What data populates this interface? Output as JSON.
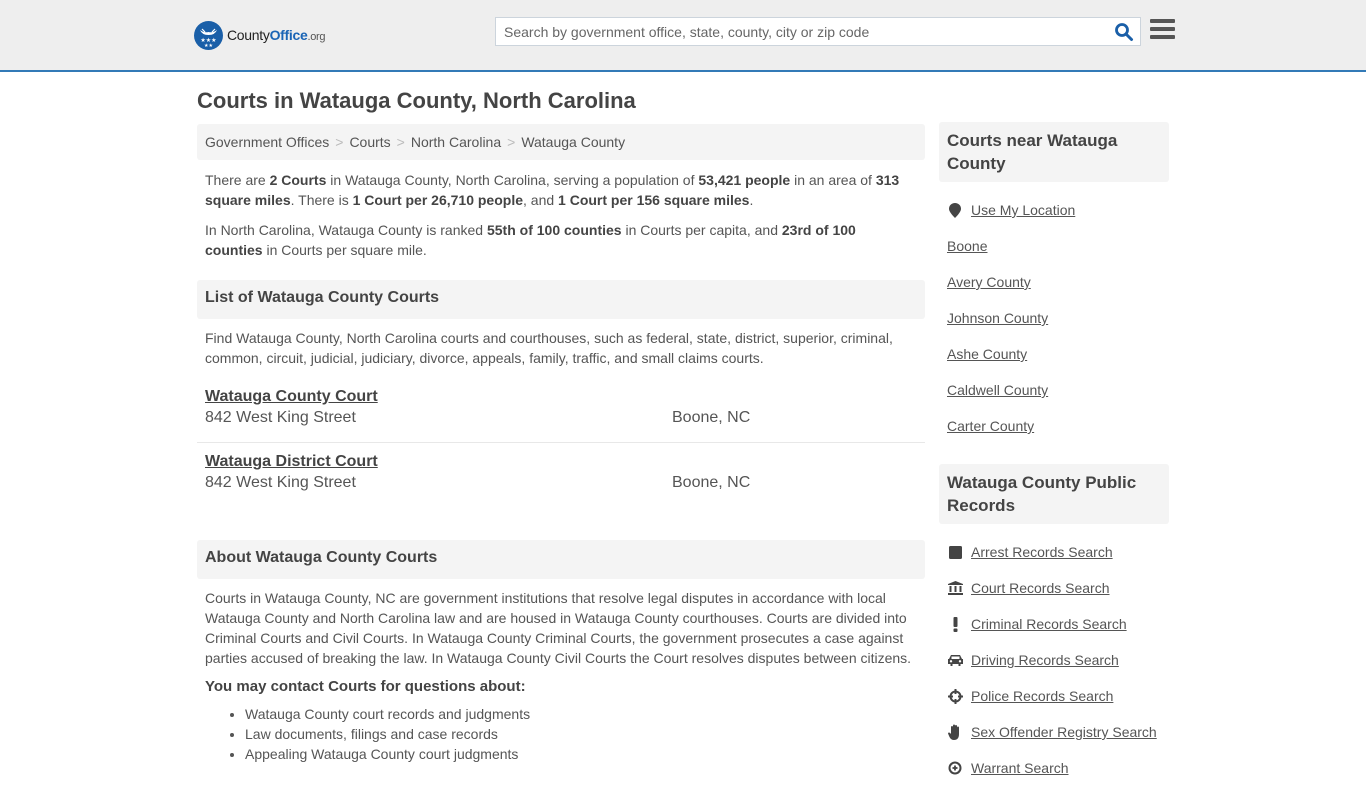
{
  "header": {
    "logo": {
      "county": "County",
      "office": "Office",
      "org": ".org"
    },
    "search": {
      "placeholder": "Search by government office, state, county, city or zip code",
      "value": ""
    },
    "search_icon": "magnifier-icon",
    "menu_icon": "hamburger-icon"
  },
  "page_title": "Courts in Watauga County, North Carolina",
  "breadcrumb": [
    "Government Offices",
    "Courts",
    "North Carolina",
    "Watauga County"
  ],
  "summary": {
    "p1": {
      "t1": "There are ",
      "b1": "2 Courts",
      "t2": " in Watauga County, North Carolina, serving a population of ",
      "b2": "53,421 people",
      "t3": " in an area of ",
      "b3": "313 square miles",
      "t4": ". There is ",
      "b4": "1 Court per 26,710 people",
      "t5": ", and ",
      "b5": "1 Court per 156 square miles",
      "t6": "."
    },
    "p2": {
      "t1": "In North Carolina, Watauga County is ranked ",
      "b1": "55th of 100 counties",
      "t2": " in Courts per capita, and ",
      "b2": "23rd of 100 counties",
      "t3": " in Courts per square mile."
    }
  },
  "list_section": {
    "heading": "List of Watauga County Courts",
    "intro": "Find Watauga County, North Carolina courts and courthouses, such as federal, state, district, superior, criminal, common, circuit, judicial, judiciary, divorce, appeals, family, traffic, and small claims courts.",
    "courts": [
      {
        "name": "Watauga County Court",
        "address": "842 West King Street",
        "city": "Boone, NC"
      },
      {
        "name": "Watauga District Court",
        "address": "842 West King Street",
        "city": "Boone, NC"
      }
    ]
  },
  "about_section": {
    "heading": "About Watauga County Courts",
    "text": "Courts in Watauga County, NC are government institutions that resolve legal disputes in accordance with local Watauga County and North Carolina law and are housed in Watauga County courthouses. Courts are divided into Criminal Courts and Civil Courts. In Watauga County Criminal Courts, the government prosecutes a case against parties accused of breaking the law. In Watauga County Civil Courts the Court resolves disputes between citizens.",
    "contact_heading": "You may contact Courts for questions about:",
    "contact_items": [
      "Watauga County court records and judgments",
      "Law documents, filings and case records",
      "Appealing Watauga County court judgments"
    ]
  },
  "sidebar": {
    "nearby": {
      "heading": "Courts near Watauga County",
      "use_location": "Use My Location",
      "items": [
        "Boone",
        "Avery County",
        "Johnson County",
        "Ashe County",
        "Caldwell County",
        "Carter County"
      ]
    },
    "public_records": {
      "heading": "Watauga County Public Records",
      "items": [
        {
          "label": "Arrest Records Search",
          "icon": "square-icon"
        },
        {
          "label": "Court Records Search",
          "icon": "courthouse-icon"
        },
        {
          "label": "Criminal Records Search",
          "icon": "exclamation-icon"
        },
        {
          "label": "Driving Records Search",
          "icon": "car-icon"
        },
        {
          "label": "Police Records Search",
          "icon": "crosshair-icon"
        },
        {
          "label": "Sex Offender Registry Search",
          "icon": "hand-icon"
        },
        {
          "label": "Warrant Search",
          "icon": "search-plus-icon"
        }
      ]
    }
  }
}
